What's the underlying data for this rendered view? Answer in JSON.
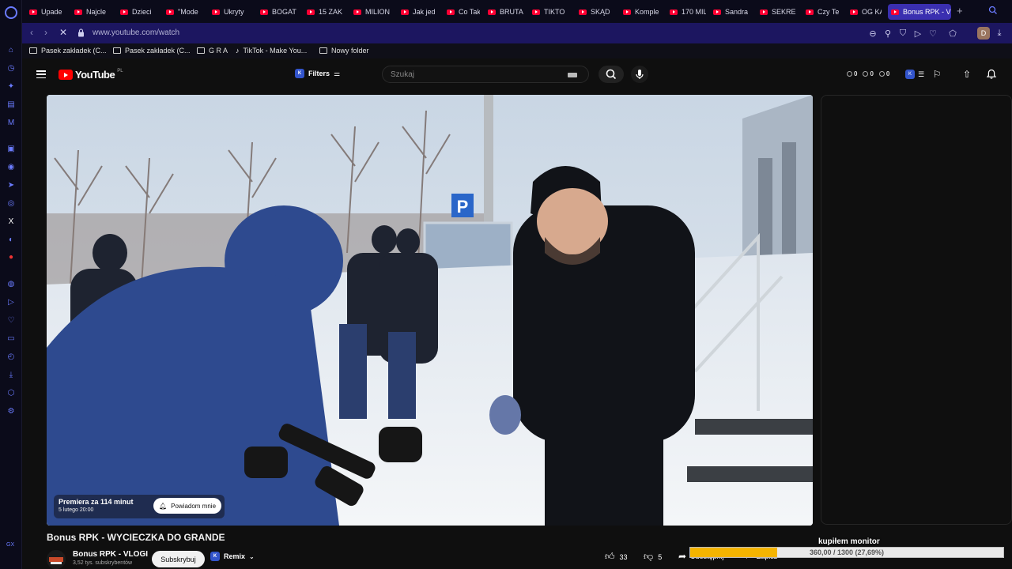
{
  "browser": {
    "tabs": [
      {
        "label": "Upade"
      },
      {
        "label": "Najcle"
      },
      {
        "label": "Dzieci"
      },
      {
        "label": "\"Mode"
      },
      {
        "label": "Ukryty"
      },
      {
        "label": "BOGAT"
      },
      {
        "label": "15 ZAK"
      },
      {
        "label": "MILION"
      },
      {
        "label": "Jak jed"
      },
      {
        "label": "Co Tak"
      },
      {
        "label": "BRUTA"
      },
      {
        "label": "TIKTO"
      },
      {
        "label": "SKĄD"
      },
      {
        "label": "Komple"
      },
      {
        "label": "170 MIL"
      },
      {
        "label": "Sandra"
      },
      {
        "label": "SEKRE"
      },
      {
        "label": "Czy Te"
      },
      {
        "label": "OG KA"
      },
      {
        "label": "Bonus RPK - V",
        "active": true
      }
    ],
    "url": "www.youtube.com/watch",
    "profile_initial": "D",
    "bookmarks": [
      {
        "label": "Pasek zakładek (C...",
        "icon": "folder-icon"
      },
      {
        "label": "Pasek zakładek (C...",
        "icon": "folder-icon"
      },
      {
        "label": "G R A",
        "icon": "folder-icon"
      },
      {
        "label": "TikTok - Make You...",
        "icon": "tiktok-icon"
      },
      {
        "label": "Nowy folder",
        "icon": "folder-icon"
      }
    ],
    "accent": "#6a7bff",
    "active_tab_color": "#3a2fb0"
  },
  "youtube": {
    "logo_text": "YouTube",
    "country_code": "PL",
    "filters_label": "Filters",
    "search_placeholder": "Szukaj",
    "stats": [
      "0",
      "0",
      "0"
    ],
    "player": {
      "premiere_label": "Premiera za 114 minut",
      "premiere_date": "5 lutego 20:00",
      "notify_label": "Powiadom mnie"
    },
    "video": {
      "title": "Bonus RPK - WYCIECZKA DO GRANDE",
      "channel_name": "Bonus RPK - VLOGI",
      "subscribers": "3,52 tys. subskrybentów",
      "subscribe_label": "Subskrybuj",
      "remix_label": "Remix",
      "likes": "33",
      "dislikes": "5",
      "share_label": "Udostępnij",
      "save_label": "Zapisz"
    }
  },
  "donation_goal": {
    "title": "kupiłem monitor",
    "text": "360,00 / 1300 (27,69%)",
    "progress": 0.2769,
    "fill_color": "#f4b400"
  },
  "sidebar_bottom_label": "GX"
}
